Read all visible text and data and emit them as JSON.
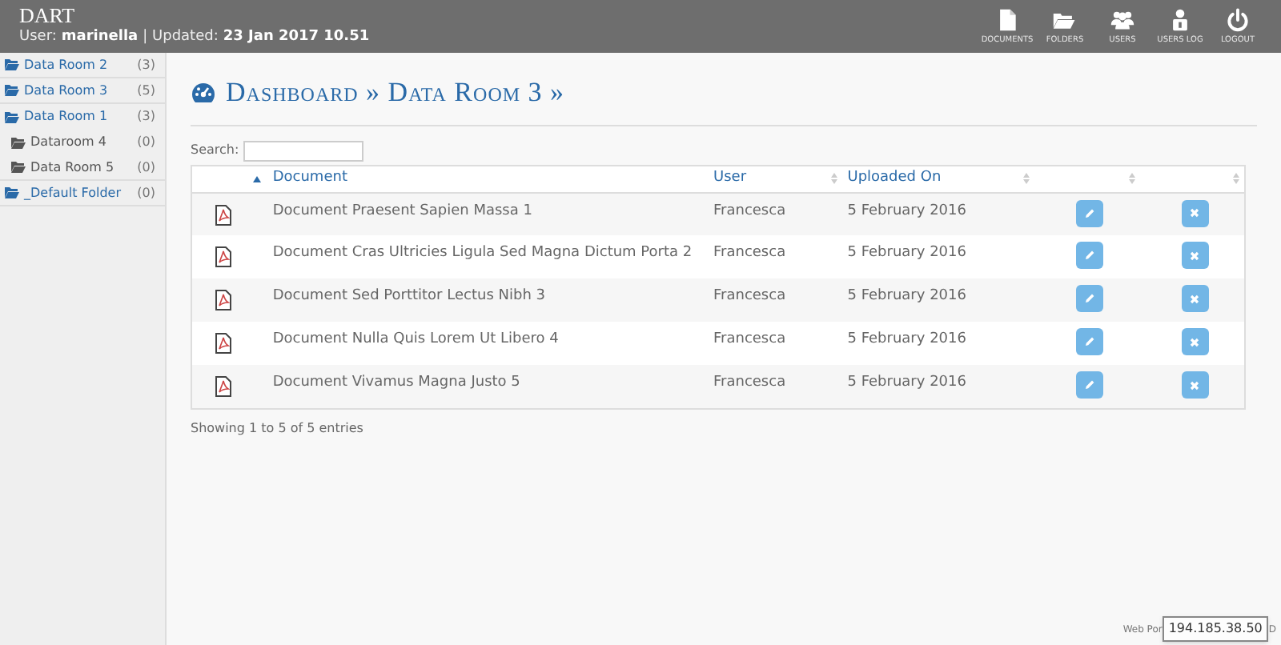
{
  "header": {
    "app_title": "DART",
    "user_label": "User:",
    "user": "marinella",
    "updated_label": "| Updated:",
    "updated": "23 Jan 2017 10.51",
    "nav": [
      {
        "kind": "documents",
        "label": "DOCUMENTS"
      },
      {
        "kind": "folders",
        "label": "FOLDERS"
      },
      {
        "kind": "users",
        "label": "USERS"
      },
      {
        "kind": "users_log",
        "label": "USERS LOG"
      },
      {
        "kind": "logout",
        "label": "LOGOUT"
      }
    ]
  },
  "sidebar": {
    "items": [
      {
        "label": "Data Room 2",
        "count": "(3)"
      },
      {
        "label": "Data Room 3",
        "count": "(5)"
      },
      {
        "label": "Data Room 1",
        "count": "(3)",
        "children": [
          {
            "label": "Dataroom 4",
            "count": "(0)"
          },
          {
            "label": "Data Room 5",
            "count": "(0)"
          }
        ]
      },
      {
        "label": "_Default Folder",
        "count": "(0)"
      }
    ]
  },
  "breadcrumb": "Dashboard » Data Room 3 »",
  "search": {
    "label": "Search:"
  },
  "table": {
    "columns": [
      {
        "label": "Document",
        "sorted": true
      },
      {
        "label": "User",
        "sorted": false
      },
      {
        "label": "Uploaded On",
        "sorted": false
      },
      {
        "sorted": false
      },
      {
        "sorted": false
      }
    ],
    "rows": [
      {
        "document": "Document Praesent Sapien Massa 1",
        "user": "Francesca",
        "uploaded": "5 February 2016"
      },
      {
        "document": "Document Cras Ultricies Ligula Sed Magna Dictum Porta 2",
        "user": "Francesca",
        "uploaded": "5 February 2016"
      },
      {
        "document": "Document Sed Porttitor Lectus Nibh 3",
        "user": "Francesca",
        "uploaded": "5 February 2016"
      },
      {
        "document": "Document Nulla Quis Lorem Ut Libero 4",
        "user": "Francesca",
        "uploaded": "5 February 2016"
      },
      {
        "document": "Document Vivamus Magna Justo 5",
        "user": "Francesca",
        "uploaded": "5 February 2016"
      }
    ]
  },
  "info": "Showing 1 to 5 of 5 entries",
  "footer": {
    "text_start": "Web Por",
    "tooltip": "194.185.38.50",
    "text_end": "D"
  }
}
